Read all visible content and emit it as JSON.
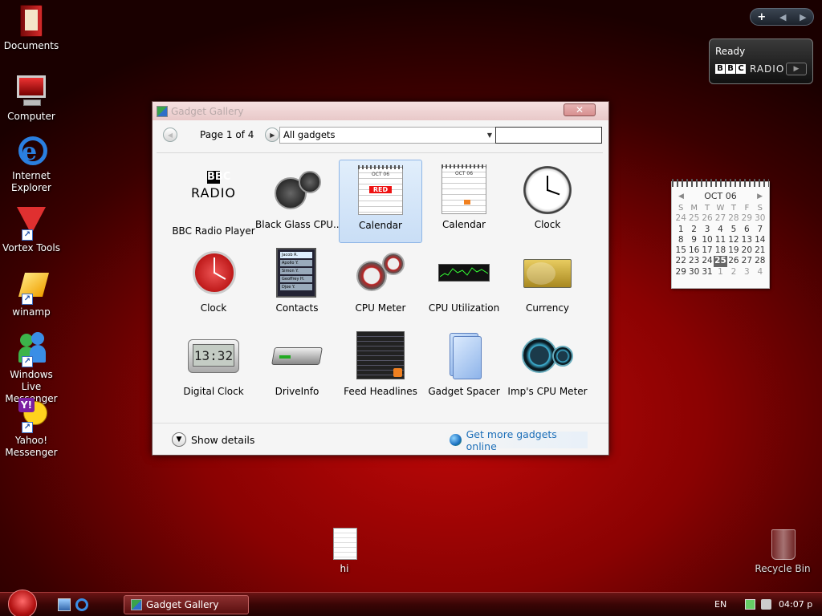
{
  "desktop": {
    "icons": [
      {
        "label": "Documents"
      },
      {
        "label": "Computer"
      },
      {
        "label": "Internet Explorer"
      },
      {
        "label": "Vortex Tools"
      },
      {
        "label": "winamp"
      },
      {
        "label": "Windows Live Messenger"
      },
      {
        "label": "Yahoo! Messenger"
      },
      {
        "label": "hi"
      },
      {
        "label": "Recycle Bin"
      }
    ]
  },
  "sidebar": {
    "add_label": "+",
    "prev_label": "◀",
    "next_label": "▶",
    "bbc_gadget": {
      "status": "Ready",
      "brand": [
        "B",
        "B",
        "C"
      ],
      "radio": "RADIO"
    },
    "calendar_gadget": {
      "month": "OCT 06",
      "dow": [
        "S",
        "M",
        "T",
        "W",
        "T",
        "F",
        "S"
      ],
      "weeks": [
        [
          "24",
          "25",
          "26",
          "27",
          "28",
          "29",
          "30"
        ],
        [
          "1",
          "2",
          "3",
          "4",
          "5",
          "6",
          "7"
        ],
        [
          "8",
          "9",
          "10",
          "11",
          "12",
          "13",
          "14"
        ],
        [
          "15",
          "16",
          "17",
          "18",
          "19",
          "20",
          "21"
        ],
        [
          "22",
          "23",
          "24",
          "25",
          "26",
          "27",
          "28"
        ],
        [
          "29",
          "30",
          "31",
          "1",
          "2",
          "3",
          "4"
        ]
      ],
      "today": "25"
    }
  },
  "window": {
    "title": "Gadget Gallery",
    "close_label": "✕",
    "page_label": "Page 1 of 4",
    "filter_value": "All gadgets",
    "search_value": "",
    "gadgets": [
      {
        "name": "BBC Radio Player"
      },
      {
        "name": "Black Glass CPU..."
      },
      {
        "name": "Calendar",
        "selected": true
      },
      {
        "name": "Calendar"
      },
      {
        "name": "Clock"
      },
      {
        "name": "Clock"
      },
      {
        "name": "Contacts"
      },
      {
        "name": "CPU Meter"
      },
      {
        "name": "CPU Utilization"
      },
      {
        "name": "Currency"
      },
      {
        "name": "Digital Clock"
      },
      {
        "name": "DriveInfo"
      },
      {
        "name": "Feed Headlines"
      },
      {
        "name": "Gadget Spacer"
      },
      {
        "name": "Imp's CPU Meter"
      }
    ],
    "icon_text": {
      "bbc": "BBC",
      "radio": "RADIO",
      "cal_month": "OCT 06",
      "cal_badge": "RED",
      "digital_time": "13:32",
      "contact_names": [
        "Jacob R.",
        "Apollo Y.",
        "Simon Y.",
        "Geoffrey H.",
        "Djoe Y."
      ]
    },
    "show_details_label": "Show details",
    "get_more_label": "Get more gadgets online"
  },
  "taskbar": {
    "task_label": "Gadget Gallery",
    "lang": "EN",
    "time": "04:07 p"
  }
}
